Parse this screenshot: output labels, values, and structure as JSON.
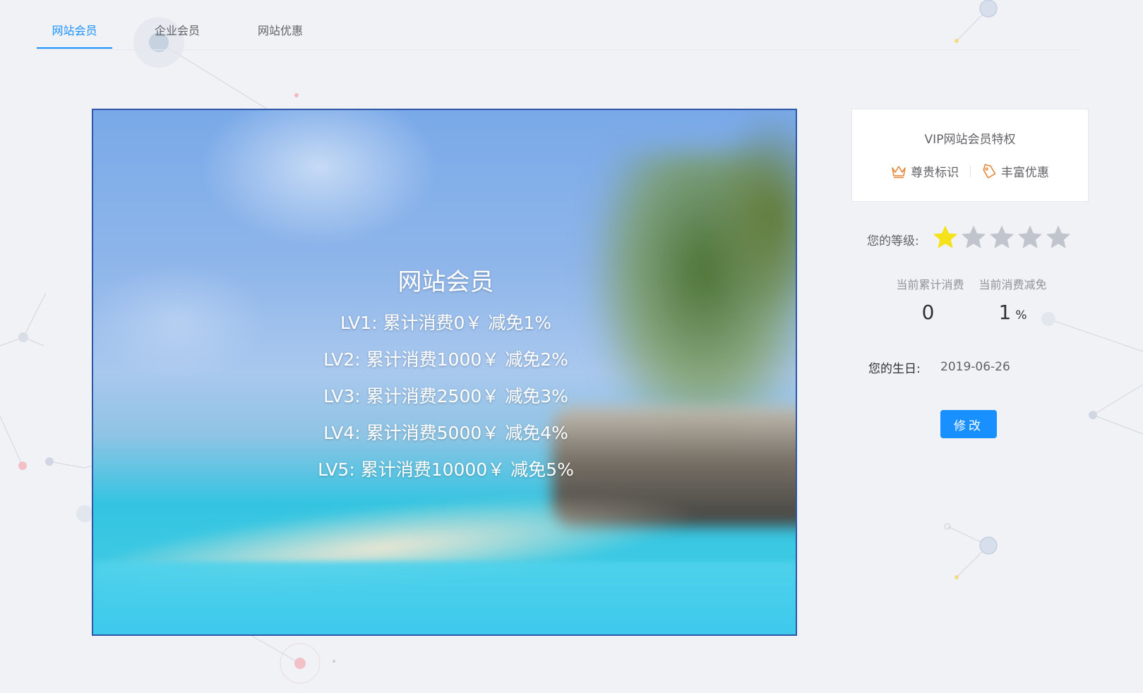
{
  "tabs": [
    {
      "label": "网站会员",
      "active": true
    },
    {
      "label": "企业会员",
      "active": false
    },
    {
      "label": "网站优惠",
      "active": false
    }
  ],
  "banner": {
    "title": "网站会员",
    "levels": [
      "LV1: 累计消费0￥ 减免1%",
      "LV2: 累计消费1000￥ 减免2%",
      "LV3: 累计消费2500￥ 减免3%",
      "LV4: 累计消费5000￥ 减免4%",
      "LV5: 累计消费10000￥ 减免5%"
    ]
  },
  "privileges_panel": {
    "title": "VIP网站会员特权",
    "items": [
      {
        "icon": "crown-icon",
        "label": "尊贵标识"
      },
      {
        "icon": "tag-icon",
        "label": "丰富优惠"
      }
    ]
  },
  "level": {
    "label": "您的等级:",
    "rating": 1,
    "max": 5
  },
  "stats": [
    {
      "label": "当前累计消费",
      "value": "0",
      "unit": ""
    },
    {
      "label": "当前消费减免",
      "value": "1",
      "unit": "%"
    }
  ],
  "birthday": {
    "label": "您的生日:",
    "value": "2019-06-26"
  },
  "edit_button_label": "修改",
  "colors": {
    "accent": "#1890ff",
    "star_active": "#f5e21b",
    "star_inactive": "#c0c4cc",
    "icon_orange": "#e6873a",
    "banner_border": "#2d55a8"
  }
}
